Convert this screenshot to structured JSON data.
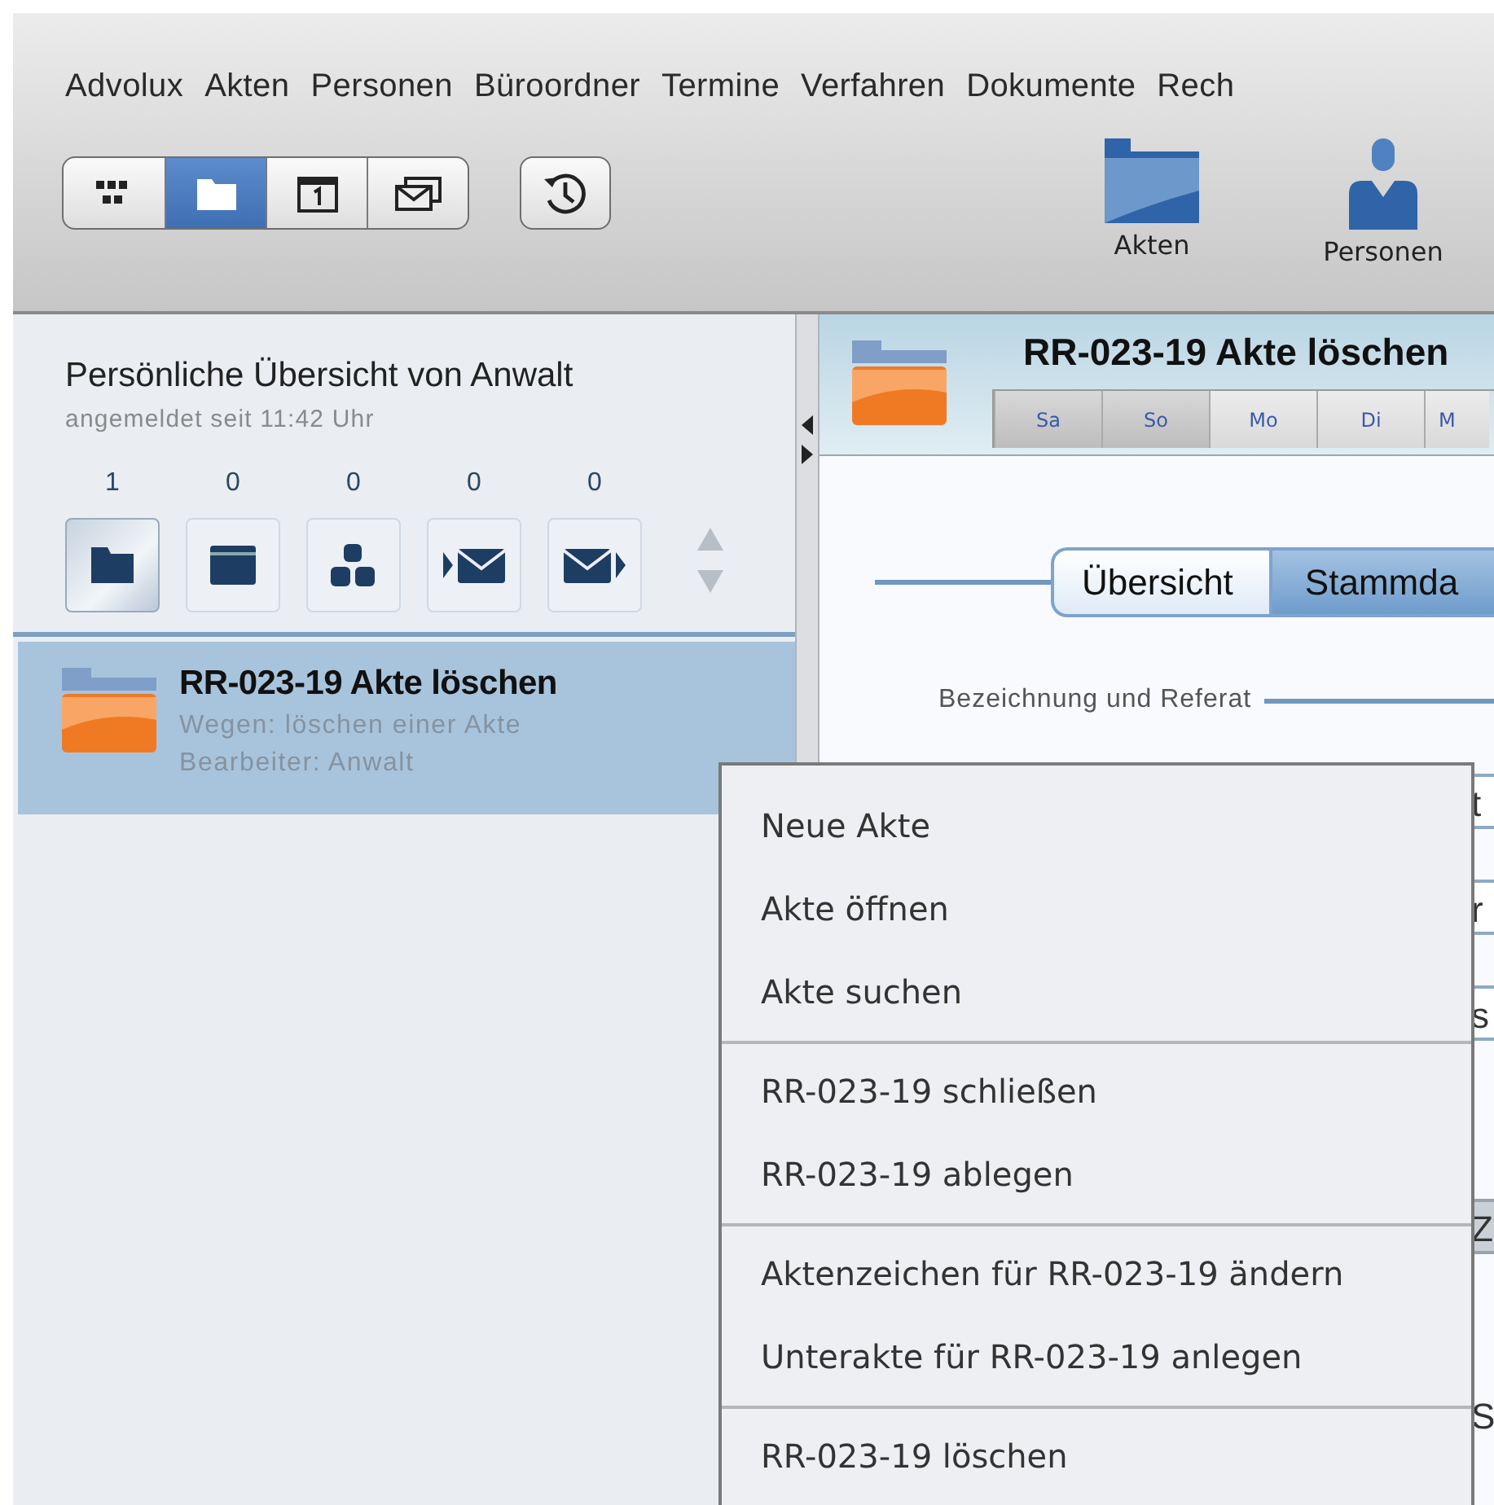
{
  "menu_bar": [
    "Advolux",
    "Akten",
    "Personen",
    "Büroordner",
    "Termine",
    "Verfahren",
    "Dokumente",
    "Rech"
  ],
  "view_switch": [
    {
      "kind": "grid",
      "selected": false
    },
    {
      "kind": "folder",
      "selected": true
    },
    {
      "kind": "calendar",
      "selected": false
    },
    {
      "kind": "mail",
      "selected": false
    }
  ],
  "quick_launch": [
    {
      "label": "Akten",
      "kind": "folder"
    },
    {
      "label": "Personen",
      "kind": "person"
    }
  ],
  "overview": {
    "title": "Persönliche Übersicht von Anwalt",
    "subtitle": "angemeldet seit 11:42 Uhr",
    "counters": [
      {
        "count": "1",
        "kind": "folder",
        "selected": true
      },
      {
        "count": "0",
        "kind": "window",
        "selected": false
      },
      {
        "count": "0",
        "kind": "blocks",
        "selected": false
      },
      {
        "count": "0",
        "kind": "mail-in",
        "selected": false
      },
      {
        "count": "0",
        "kind": "mail-out",
        "selected": false
      }
    ]
  },
  "file_list": [
    {
      "title": "RR-023-19 Akte löschen",
      "subject": "Wegen: löschen einer Akte",
      "editor": "Bearbeiter: Anwalt",
      "selected": true
    }
  ],
  "file_panel": {
    "title": "RR-023-19 Akte löschen",
    "day_tabs": [
      {
        "label": "Sa",
        "kind": "weekend"
      },
      {
        "label": "So",
        "kind": "weekend"
      },
      {
        "label": "Mo",
        "kind": "weekday"
      },
      {
        "label": "Di",
        "kind": "weekday"
      },
      {
        "label": "M",
        "kind": "weekday"
      }
    ],
    "section_tabs": [
      {
        "label": "Übersicht",
        "selected": false
      },
      {
        "label": "Stammda",
        "selected": true
      }
    ],
    "section_label": "Bezeichnung und Referat",
    "covered_fragments": [
      {
        "text": "t",
        "kind": "field"
      },
      {
        "text": "r",
        "kind": "field"
      },
      {
        "text": "s",
        "kind": "field"
      },
      {
        "text": "Z",
        "kind": "header"
      },
      {
        "text": "S",
        "kind": "text"
      }
    ]
  },
  "context_menu": {
    "groups": [
      [
        "Neue Akte",
        "Akte öffnen",
        "Akte suchen"
      ],
      [
        "RR-023-19 schließen",
        "RR-023-19 ablegen"
      ],
      [
        "Aktenzeichen für RR-023-19 ändern",
        "Unterakte für RR-023-19 anlegen"
      ],
      [
        "RR-023-19 löschen"
      ]
    ]
  }
}
